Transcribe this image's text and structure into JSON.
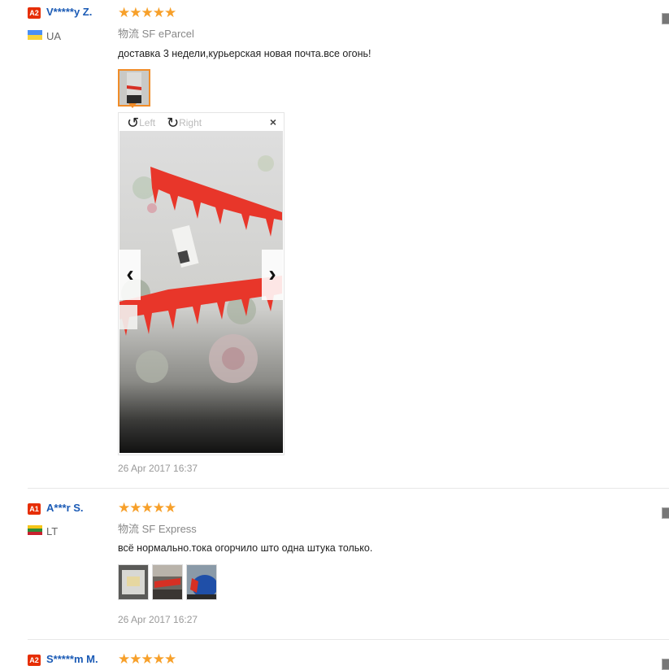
{
  "reviews": [
    {
      "level": "A2",
      "user": "V*****y Z.",
      "country": "UA",
      "flag_colors": [
        "#4a8ff5",
        "#f7d33a"
      ],
      "stars": "★★★★★",
      "rating": 5,
      "shipping": "物流 SF eParcel",
      "feedback": "доставка 3 недели,курьерская новая почта.все огонь!",
      "date": "26 Apr 2017 16:37"
    },
    {
      "level": "A1",
      "user": "A***r S.",
      "country": "LT",
      "flag_colors": [
        "#f5c518",
        "#2e8b3a",
        "#c8202e"
      ],
      "stars": "★★★★★",
      "rating": 5,
      "shipping": "物流 SF Express",
      "feedback": "всё нормально.тока огорчило што одна штука только.",
      "date": "26 Apr 2017 16:27"
    },
    {
      "level": "A2",
      "user": "S*****m M.",
      "stars": "★★★★★",
      "rating": 5
    }
  ],
  "viewer": {
    "rotate_left_icon": "rotate-left-icon",
    "rotate_left_label": "Left",
    "rotate_right_icon": "rotate-right-icon",
    "rotate_right_label": "Right",
    "close": "×",
    "prev": "‹",
    "next": "›"
  },
  "colors": {
    "username": "#1a5ab5",
    "star": "#f7a02a",
    "level_badge": "#e62e04",
    "thumb_active_border": "#f08c28"
  }
}
